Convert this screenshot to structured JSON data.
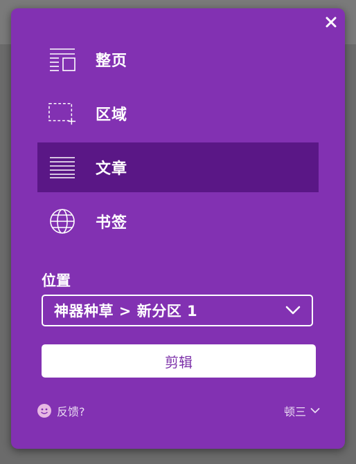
{
  "close": {
    "icon": "close-icon",
    "symbol": "✕"
  },
  "menu": {
    "items": [
      {
        "label": "整页",
        "icon": "full-page-icon",
        "selected": false
      },
      {
        "label": "区域",
        "icon": "region-select-icon",
        "selected": false
      },
      {
        "label": "文章",
        "icon": "article-icon",
        "selected": true
      },
      {
        "label": "书签",
        "icon": "bookmark-globe-icon",
        "selected": false
      }
    ]
  },
  "location": {
    "label": "位置",
    "value": "神器种草 > 新分区 1"
  },
  "clip_button": {
    "label": "剪辑"
  },
  "footer": {
    "feedback_label": "反馈?",
    "account_label": "顿三"
  },
  "colors": {
    "panel": "#8231b2",
    "selected": "#5a1786",
    "button_text": "#7b2fa8"
  }
}
